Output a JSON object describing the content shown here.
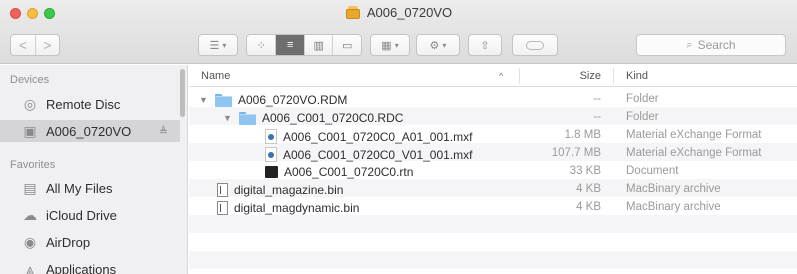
{
  "window": {
    "title": "A006_0720VO"
  },
  "toolbar": {
    "nav_back_label": "<",
    "nav_forward_label": ">",
    "search_placeholder": "Search"
  },
  "sidebar": {
    "sections": [
      {
        "label": "Devices",
        "items": [
          {
            "label": "Remote Disc",
            "icon": "disc-icon"
          },
          {
            "label": "A006_0720VO",
            "icon": "drive-icon",
            "selected": true,
            "eject": true
          }
        ]
      },
      {
        "label": "Favorites",
        "items": [
          {
            "label": "All My Files",
            "icon": "all-files-icon"
          },
          {
            "label": "iCloud Drive",
            "icon": "cloud-icon"
          },
          {
            "label": "AirDrop",
            "icon": "airdrop-icon"
          },
          {
            "label": "Applications",
            "icon": "applications-icon"
          }
        ]
      }
    ]
  },
  "list": {
    "columns": {
      "name": "Name",
      "size": "Size",
      "kind": "Kind"
    },
    "rows": [
      {
        "name": "A006_0720VO.RDM",
        "size": "--",
        "kind": "Folder",
        "icon": "folder-icon",
        "level": 0,
        "expanded": true
      },
      {
        "name": "A006_C001_0720C0.RDC",
        "size": "--",
        "kind": "Folder",
        "icon": "folder-icon",
        "level": 1,
        "expanded": true
      },
      {
        "name": "A006_C001_0720C0_A01_001.mxf",
        "size": "1.8 MB",
        "kind": "Material eXchange Format",
        "icon": "mxf-file-icon",
        "level": 2
      },
      {
        "name": "A006_C001_0720C0_V01_001.mxf",
        "size": "107.7 MB",
        "kind": "Material eXchange Format",
        "icon": "mxf-file-icon",
        "level": 2
      },
      {
        "name": "A006_C001_0720C0.rtn",
        "size": "33 KB",
        "kind": "Document",
        "icon": "document-icon",
        "level": 2
      },
      {
        "name": "digital_magazine.bin",
        "size": "4 KB",
        "kind": "MacBinary archive",
        "icon": "binary-file-icon",
        "level": 0
      },
      {
        "name": "digital_magdynamic.bin",
        "size": "4 KB",
        "kind": "MacBinary archive",
        "icon": "binary-file-icon",
        "level": 0
      }
    ]
  }
}
